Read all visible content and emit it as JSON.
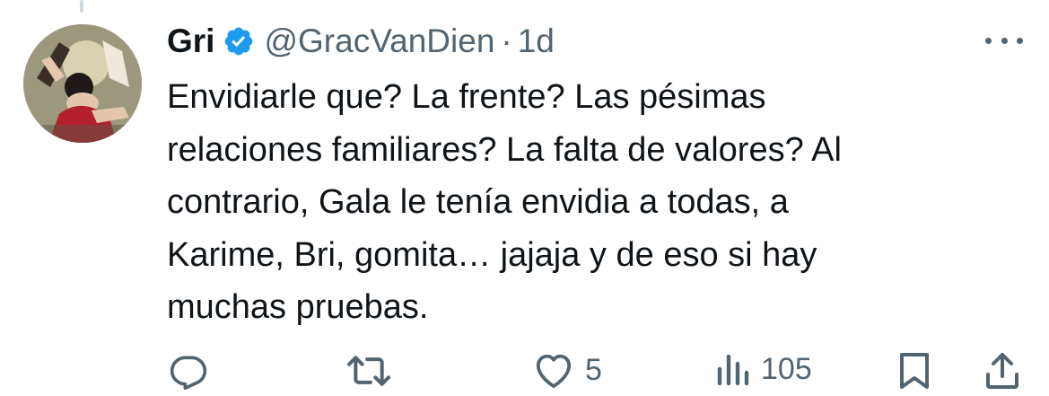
{
  "tweet": {
    "author": {
      "name": "Gri",
      "handle": "@GracVanDien",
      "verified": true
    },
    "separator": "·",
    "time": "1d",
    "text": "Envidiarle que? La frente? Las pésimas\nrelaciones familiares? La falta de valores? Al\ncontrario, Gala le tenía envidia a todas, a\nKarime, Bri, gomita… jajaja y de eso si hay\nmuchas pruebas.",
    "actions": {
      "reply": {
        "icon": "reply-icon"
      },
      "retweet": {
        "icon": "retweet-icon"
      },
      "like": {
        "icon": "heart-icon",
        "count": "5"
      },
      "views": {
        "icon": "views-icon",
        "count": "105"
      },
      "bookmark": {
        "icon": "bookmark-icon"
      },
      "share": {
        "icon": "share-icon"
      }
    }
  },
  "colors": {
    "text": "#0f1419",
    "secondary": "#536471",
    "verified": "#1d9bf0"
  }
}
